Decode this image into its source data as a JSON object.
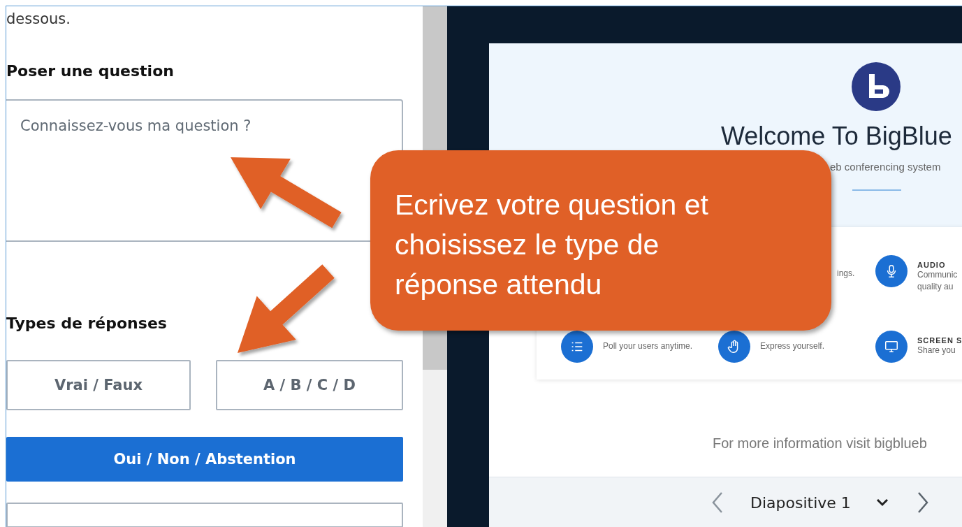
{
  "question_panel": {
    "intro_tail": "dessous.",
    "question_heading": "Poser une question",
    "question_field": {
      "placeholder": "Connaissez-vous ma question ?"
    },
    "answer_types_heading": "Types de réponses",
    "answer_types": [
      {
        "label": "Vrai / Faux",
        "selected": false
      },
      {
        "label": "A / B / C / D",
        "selected": false
      },
      {
        "label": "Oui / Non / Abstention",
        "selected": true
      }
    ]
  },
  "slide": {
    "title": "Welcome To BigBlue",
    "subtitle": "eb conferencing system",
    "features": [
      {
        "kind": "blank"
      },
      {
        "kind": "text",
        "text": "ings."
      },
      {
        "kind": "audio",
        "title": "AUDIO",
        "lines": [
          "Communic",
          "quality au"
        ]
      },
      {
        "kind": "poll",
        "lines": [
          "Poll your users anytime."
        ]
      },
      {
        "kind": "hand",
        "lines": [
          "Express yourself."
        ]
      },
      {
        "kind": "screen",
        "title": "SCREEN S",
        "lines": [
          "Share you"
        ]
      }
    ],
    "more_info": "For more information visit bigblueb"
  },
  "slide_nav": {
    "label": "Diapositive 1"
  },
  "callout": {
    "text": "Ecrivez votre question et choisissez le type de réponse attendu"
  }
}
